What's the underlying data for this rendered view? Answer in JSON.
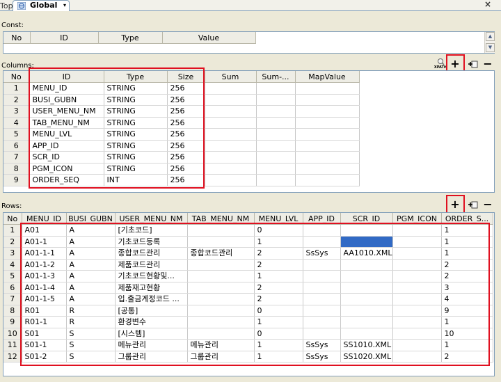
{
  "tabs": {
    "top_label": "Top",
    "active_label": "Global",
    "menu_glyph": "▾",
    "close_glyph": "×"
  },
  "const_section": {
    "label": "Const:",
    "headers": [
      "No",
      "ID",
      "Type",
      "Value"
    ]
  },
  "columns_section": {
    "label": "Columns:",
    "xpath_icon": "xpath-icon",
    "add_glyph": "+",
    "remove_glyph": "−",
    "headers": [
      "No",
      "ID",
      "Type",
      "Size",
      "Sum",
      "Sum-...",
      "MapValue"
    ],
    "rows": [
      [
        "1",
        "MENU_ID",
        "STRING",
        "256"
      ],
      [
        "2",
        "BUSI_GUBN",
        "STRING",
        "256"
      ],
      [
        "3",
        "USER_MENU_NM",
        "STRING",
        "256"
      ],
      [
        "4",
        "TAB_MENU_NM",
        "STRING",
        "256"
      ],
      [
        "5",
        "MENU_LVL",
        "STRING",
        "256"
      ],
      [
        "6",
        "APP_ID",
        "STRING",
        "256"
      ],
      [
        "7",
        "SCR_ID",
        "STRING",
        "256"
      ],
      [
        "8",
        "PGM_ICON",
        "STRING",
        "256"
      ],
      [
        "9",
        "ORDER_SEQ",
        "INT",
        "256"
      ]
    ]
  },
  "rows_section": {
    "label": "Rows:",
    "add_glyph": "+",
    "remove_glyph": "−",
    "headers": [
      "No",
      "MENU_ID",
      "BUSI_GUBN",
      "USER_MENU_NM",
      "TAB_MENU_NM",
      "MENU_LVL",
      "APP_ID",
      "SCR_ID",
      "PGM_ICON",
      "ORDER_S..."
    ],
    "rows": [
      [
        "1",
        "A01",
        "A",
        "[기초코드]",
        "",
        "0",
        "",
        "",
        "",
        "1"
      ],
      [
        "2",
        "A01-1",
        "A",
        "기초코드등록",
        "",
        "1",
        "",
        "",
        "",
        "1"
      ],
      [
        "3",
        "A01-1-1",
        "A",
        "종합코드관리",
        "종합코드관리",
        "2",
        "SsSys",
        "AA1010.XML",
        "",
        "1"
      ],
      [
        "4",
        "A01-1-2",
        "A",
        "제품코드관리",
        "",
        "2",
        "",
        "",
        "",
        "2"
      ],
      [
        "5",
        "A01-1-3",
        "A",
        "기초코드현황및...",
        "",
        "1",
        "",
        "",
        "",
        "2"
      ],
      [
        "6",
        "A01-1-4",
        "A",
        "제품재고현황",
        "",
        "2",
        "",
        "",
        "",
        "3"
      ],
      [
        "7",
        "A01-1-5",
        "A",
        "입.출금계정코드 ...",
        "",
        "2",
        "",
        "",
        "",
        "4"
      ],
      [
        "8",
        "R01",
        "R",
        "[공통]",
        "",
        "0",
        "",
        "",
        "",
        "9"
      ],
      [
        "9",
        "R01-1",
        "R",
        "환경변수",
        "",
        "1",
        "",
        "",
        "",
        "1"
      ],
      [
        "10",
        "S01",
        "S",
        "[시스템]",
        "",
        "0",
        "",
        "",
        "",
        "10"
      ],
      [
        "11",
        "S01-1",
        "S",
        "메뉴관리",
        "메뉴관리",
        "1",
        "SsSys",
        "SS1010.XML",
        "",
        "1"
      ],
      [
        "12",
        "S01-2",
        "S",
        "그룹관리",
        "그룹관리",
        "1",
        "SsSys",
        "SS1020.XML",
        "",
        "2"
      ]
    ]
  },
  "colors": {
    "highlight": "#e01020",
    "selection": "#316ac5",
    "panel": "#ece9d8"
  }
}
